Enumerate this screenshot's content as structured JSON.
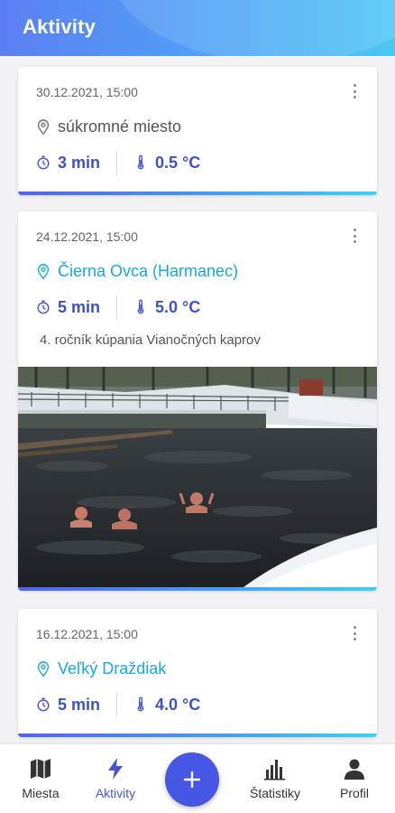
{
  "header": {
    "title": "Aktivity"
  },
  "activities": [
    {
      "date": "30.12.2021, 15:00",
      "location": "súkromné miesto",
      "duration": "3 min",
      "temperature": "0.5 °C"
    },
    {
      "date": "24.12.2021, 15:00",
      "location": "Čierna Ovca (Harmanec)",
      "duration": "5 min",
      "temperature": "5.0 °C",
      "description": "4. ročník kúpania Vianočných kaprov"
    },
    {
      "date": "16.12.2021, 15:00",
      "location": "Veľký Draždiak",
      "duration": "5 min",
      "temperature": "4.0 °C"
    }
  ],
  "nav": {
    "places_label": "Miesta",
    "activities_label": "Aktivity",
    "add_icon": "plus-icon",
    "stats_label": "Štatistiky",
    "profile_label": "Profil"
  },
  "colors": {
    "accent": "#4557e3",
    "location_link": "#17a9df",
    "stat_text": "#3f51c9"
  }
}
